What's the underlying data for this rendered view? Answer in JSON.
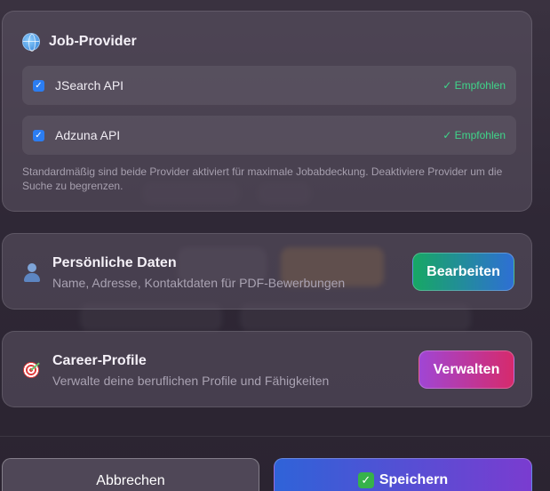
{
  "provider_card": {
    "title": "Job-Provider",
    "providers": [
      {
        "name": "JSearch API",
        "checked": true,
        "badge": "✓ Empfohlen"
      },
      {
        "name": "Adzuna API",
        "checked": true,
        "badge": "✓ Empfohlen"
      }
    ],
    "note": "Standardmäßig sind beide Provider aktiviert für maximale Jobabdeckung. Deaktiviere Provider um die Suche zu begrenzen."
  },
  "personal_card": {
    "title": "Persönliche Daten",
    "subtitle": "Name, Adresse, Kontaktdaten für PDF-Bewerbungen",
    "button_label": "Bearbeiten"
  },
  "career_card": {
    "title": "Career-Profile",
    "subtitle": "Verwalte deine beruflichen Profile und Fähigkeiten",
    "button_label": "Verwalten"
  },
  "footer": {
    "cancel_label": "Abbrechen",
    "save_label": "Speichern"
  },
  "icons": {
    "provider": "globe-icon",
    "personal": "person-icon",
    "career": "target-icon",
    "save": "check-mark-icon"
  },
  "colors": {
    "accent_blue": "#2b7df2",
    "recommended_green": "#3fd68a",
    "edit_gradient": [
      "#17a864",
      "#2e6fd4"
    ],
    "manage_gradient": [
      "#a046d4",
      "#d62a6c"
    ],
    "save_gradient": [
      "#2f63d8",
      "#7a3cd0"
    ]
  }
}
